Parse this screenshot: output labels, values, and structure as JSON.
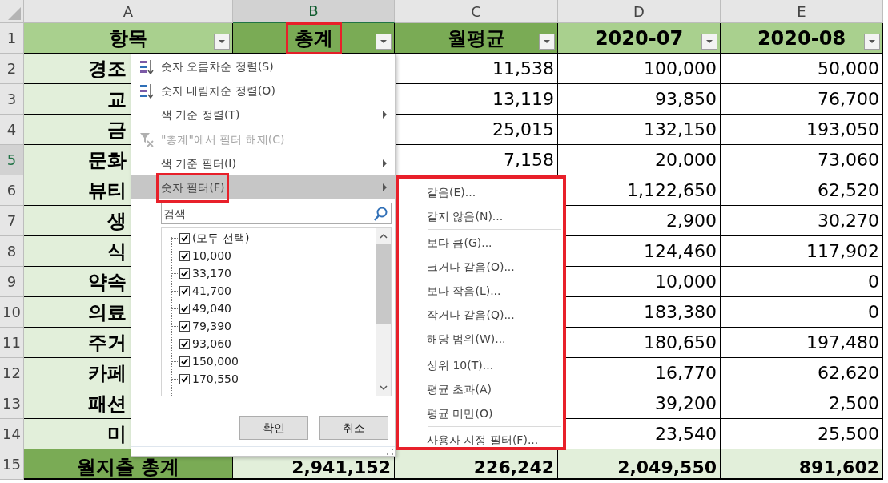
{
  "columns": [
    {
      "label": "A",
      "selected": false
    },
    {
      "label": "B",
      "selected": true
    },
    {
      "label": "C",
      "selected": false
    },
    {
      "label": "D",
      "selected": false
    },
    {
      "label": "E",
      "selected": false
    }
  ],
  "header_row": {
    "number": "1",
    "selected": false,
    "cells": [
      {
        "text": "항목",
        "color": "#a9d08e",
        "highlighted": false
      },
      {
        "text": "총계",
        "color": "#7aab55",
        "highlighted": true
      },
      {
        "text": "월평균",
        "color": "#7aab55",
        "highlighted": false
      },
      {
        "text": "2020-07",
        "color": "#a9d08e",
        "highlighted": false
      },
      {
        "text": "2020-08",
        "color": "#a9d08e",
        "highlighted": false
      }
    ]
  },
  "rows": [
    {
      "number": "2",
      "kind": "data",
      "selected": false,
      "cells": {
        "A": "경조",
        "C": "11,538",
        "D": "100,000",
        "E": "50,000"
      }
    },
    {
      "number": "3",
      "kind": "data",
      "selected": false,
      "cells": {
        "A": "교",
        "C": "13,119",
        "D": "93,850",
        "E": "76,700"
      }
    },
    {
      "number": "4",
      "kind": "data",
      "selected": false,
      "cells": {
        "A": "금",
        "C": "25,015",
        "D": "132,150",
        "E": "193,050"
      }
    },
    {
      "number": "5",
      "kind": "data",
      "selected": true,
      "cells": {
        "A": "문화",
        "C": "7,158",
        "D": "20,000",
        "E": "73,060"
      }
    },
    {
      "number": "6",
      "kind": "data",
      "selected": false,
      "cells": {
        "A": "뷰티",
        "D": "1,122,650",
        "E": "62,520"
      }
    },
    {
      "number": "7",
      "kind": "data",
      "selected": false,
      "cells": {
        "A": "생",
        "D": "2,900",
        "E": "30,270"
      }
    },
    {
      "number": "8",
      "kind": "data",
      "selected": false,
      "cells": {
        "A": "식",
        "D": "124,460",
        "E": "117,902"
      }
    },
    {
      "number": "9",
      "kind": "data",
      "selected": false,
      "cells": {
        "A": "약속",
        "D": "10,000",
        "E": "0"
      }
    },
    {
      "number": "10",
      "kind": "data",
      "selected": false,
      "cells": {
        "A": "의료",
        "D": "183,380",
        "E": "0"
      }
    },
    {
      "number": "11",
      "kind": "data",
      "selected": false,
      "cells": {
        "A": "주거",
        "D": "180,650",
        "E": "197,480"
      }
    },
    {
      "number": "12",
      "kind": "data",
      "selected": false,
      "cells": {
        "A": "카페",
        "D": "16,770",
        "E": "62,620"
      }
    },
    {
      "number": "13",
      "kind": "data",
      "selected": false,
      "cells": {
        "A": "패션",
        "D": "39,200",
        "E": "2,500"
      }
    },
    {
      "number": "14",
      "kind": "data",
      "selected": false,
      "cells": {
        "A": "미",
        "D": "23,540",
        "E": "25,500"
      }
    },
    {
      "number": "15",
      "kind": "total",
      "selected": false,
      "cells": {
        "A": "월지출 총계",
        "B": "2,941,152",
        "C": "226,242",
        "D": "2,049,550",
        "E": "891,602"
      }
    }
  ],
  "filter_menu": {
    "items": [
      {
        "kind": "sort_ascending",
        "label": "숫자 오름차순 정렬(S)",
        "disabled": false,
        "submenu": false,
        "selected": false,
        "highlighted": false
      },
      {
        "kind": "sort_descending",
        "label": "숫자 내림차순 정렬(O)",
        "disabled": false,
        "submenu": false,
        "selected": false,
        "highlighted": false
      },
      {
        "kind": "plain",
        "label": "색 기준 정렬(T)",
        "disabled": false,
        "submenu": true,
        "selected": false,
        "highlighted": false
      },
      {
        "kind": "separator"
      },
      {
        "kind": "clear_filter",
        "label": "\"총계\"에서 필터 해제(C)",
        "disabled": true,
        "submenu": false,
        "selected": false,
        "highlighted": false
      },
      {
        "kind": "plain",
        "label": "색 기준 필터(I)",
        "disabled": false,
        "submenu": true,
        "selected": false,
        "highlighted": false
      },
      {
        "kind": "plain",
        "label": "숫자 필터(F)",
        "disabled": false,
        "submenu": true,
        "selected": true,
        "highlighted": true
      }
    ],
    "search": {
      "placeholder": "검색"
    },
    "values": [
      {
        "label": "(모두 선택)",
        "checked": true
      },
      {
        "label": "10,000",
        "checked": true
      },
      {
        "label": "33,170",
        "checked": true
      },
      {
        "label": "41,700",
        "checked": true
      },
      {
        "label": "49,040",
        "checked": true
      },
      {
        "label": "79,390",
        "checked": true
      },
      {
        "label": "93,060",
        "checked": true
      },
      {
        "label": "150,000",
        "checked": true
      },
      {
        "label": "170,550",
        "checked": true
      }
    ],
    "buttons": [
      "확인",
      "취소"
    ]
  },
  "number_filter_submenu": {
    "highlighted": true,
    "items": [
      {
        "kind": "item",
        "label": "같음(E)..."
      },
      {
        "kind": "item",
        "label": "같지 않음(N)..."
      },
      {
        "kind": "separator"
      },
      {
        "kind": "item",
        "label": "보다 큼(G)..."
      },
      {
        "kind": "item",
        "label": "크거나 같음(O)..."
      },
      {
        "kind": "item",
        "label": "보다 작음(L)..."
      },
      {
        "kind": "item",
        "label": "작거나 같음(Q)..."
      },
      {
        "kind": "item",
        "label": "해당 범위(W)..."
      },
      {
        "kind": "separator"
      },
      {
        "kind": "item",
        "label": "상위 10(T)..."
      },
      {
        "kind": "item",
        "label": "평균 초과(A)"
      },
      {
        "kind": "item",
        "label": "평균 미만(O)"
      },
      {
        "kind": "separator"
      },
      {
        "kind": "item",
        "label": "사용자 지정 필터(F)..."
      }
    ]
  }
}
